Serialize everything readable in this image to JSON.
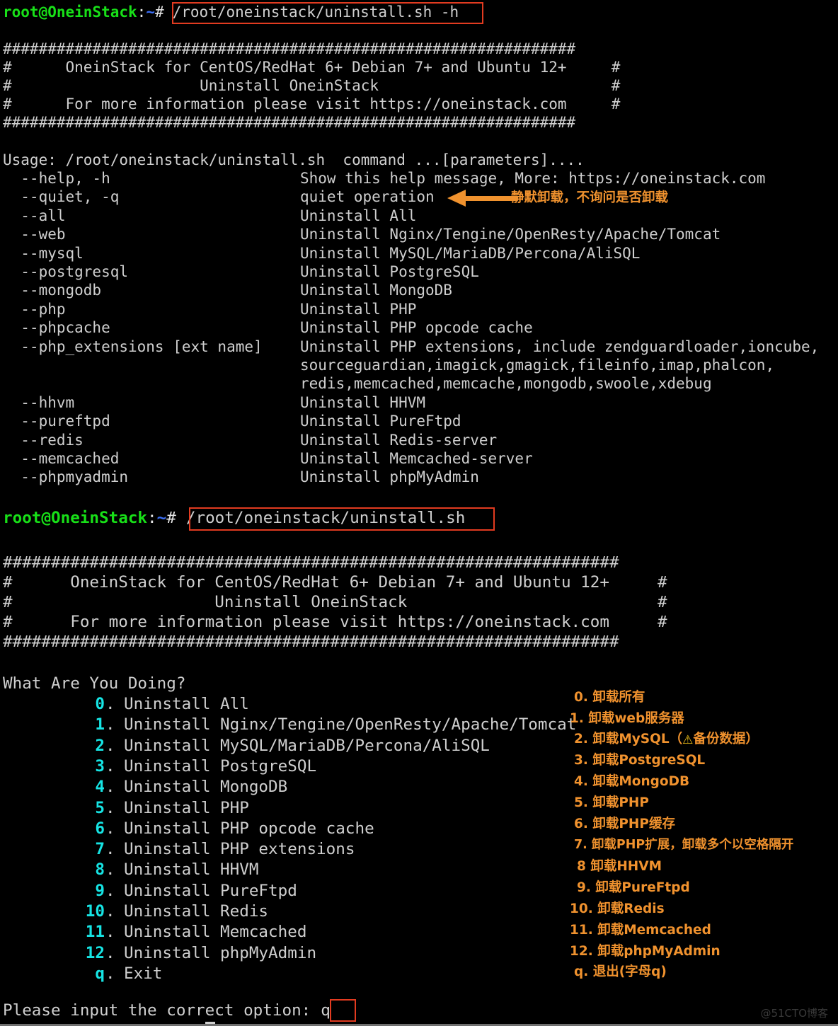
{
  "terminal": {
    "prompt": {
      "user_host": "root@OneinStack",
      "colon": ":",
      "path": "~",
      "sigil": "#"
    },
    "command_1": "/root/oneinstack/uninstall.sh -h",
    "command_2": "/root/oneinstack/uninstall.sh",
    "banner": {
      "rule": "################################################################",
      "line1": "#      OneinStack for CentOS/RedHat 6+ Debian 7+ and Ubuntu 12+     #",
      "line2": "#                     Uninstall OneinStack                          #",
      "line3": "#      For more information please visit https://oneinstack.com     #"
    },
    "usage_line": "Usage: /root/oneinstack/uninstall.sh  command ...[parameters]....",
    "options": [
      {
        "flag": "  --help, -h",
        "desc": "Show this help message, More: https://oneinstack.com"
      },
      {
        "flag": "  --quiet, -q",
        "desc": "quiet operation"
      },
      {
        "flag": "  --all",
        "desc": "Uninstall All"
      },
      {
        "flag": "  --web",
        "desc": "Uninstall Nginx/Tengine/OpenResty/Apache/Tomcat"
      },
      {
        "flag": "  --mysql",
        "desc": "Uninstall MySQL/MariaDB/Percona/AliSQL"
      },
      {
        "flag": "  --postgresql",
        "desc": "Uninstall PostgreSQL"
      },
      {
        "flag": "  --mongodb",
        "desc": "Uninstall MongoDB"
      },
      {
        "flag": "  --php",
        "desc": "Uninstall PHP"
      },
      {
        "flag": "  --phpcache",
        "desc": "Uninstall PHP opcode cache"
      },
      {
        "flag": "  --php_extensions [ext name]",
        "desc": "Uninstall PHP extensions, include zendguardloader,ioncube,"
      },
      {
        "flag": "",
        "desc": "sourceguardian,imagick,gmagick,fileinfo,imap,phalcon,"
      },
      {
        "flag": "",
        "desc": "redis,memcached,memcache,mongodb,swoole,xdebug"
      },
      {
        "flag": "  --hhvm",
        "desc": "Uninstall HHVM"
      },
      {
        "flag": "  --pureftpd",
        "desc": "Uninstall PureFtpd"
      },
      {
        "flag": "  --redis",
        "desc": "Uninstall Redis-server"
      },
      {
        "flag": "  --memcached",
        "desc": "Uninstall Memcached-server"
      },
      {
        "flag": "  --phpmyadmin",
        "desc": "Uninstall phpMyAdmin"
      }
    ],
    "menu_title": "What Are You Doing?",
    "menu_items": [
      {
        "key": "0",
        "label": "Uninstall All"
      },
      {
        "key": "1",
        "label": "Uninstall Nginx/Tengine/OpenResty/Apache/Tomcat"
      },
      {
        "key": "2",
        "label": "Uninstall MySQL/MariaDB/Percona/AliSQL"
      },
      {
        "key": "3",
        "label": "Uninstall PostgreSQL"
      },
      {
        "key": "4",
        "label": "Uninstall MongoDB"
      },
      {
        "key": "5",
        "label": "Uninstall PHP"
      },
      {
        "key": "6",
        "label": "Uninstall PHP opcode cache"
      },
      {
        "key": "7",
        "label": "Uninstall PHP extensions"
      },
      {
        "key": "8",
        "label": "Uninstall HHVM"
      },
      {
        "key": "9",
        "label": "Uninstall PureFtpd"
      },
      {
        "key": "10",
        "label": "Uninstall Redis"
      },
      {
        "key": "11",
        "label": "Uninstall Memcached"
      },
      {
        "key": "12",
        "label": "Uninstall phpMyAdmin"
      },
      {
        "key": "q",
        "label": "Exit"
      }
    ],
    "input_prompt": "Please input the correct option:",
    "input_value": "q"
  },
  "annotations": {
    "quiet": "静默卸载，不询问是否卸载",
    "menu": [
      "0. 卸载所有",
      "1. 卸载web服务器",
      "2. 卸载MySQL（",
      "3. 卸载PostgreSQL",
      "4. 卸载MongoDB",
      "5. 卸载PHP",
      "6. 卸载PHP缓存",
      "7. 卸载PHP扩展，卸载多个以空格隔开",
      "8 卸载HHVM",
      "9. 卸载PureFtpd",
      "10. 卸载Redis",
      "11. 卸载Memcached",
      "12. 卸载phpMyAdmin",
      "q. 退出(字母q)"
    ],
    "mysql_warn_suffix": "备份数据）",
    "warning_icon": "⚠"
  },
  "watermark": "@51CTO博客",
  "colors": {
    "background": "#000000",
    "foreground": "#cfcfcf",
    "prompt_green": "#18e018",
    "prompt_blue": "#3b6ef5",
    "menu_cyan": "#16e4e4",
    "annotation_orange": "#f0922e",
    "highlight_red": "#e23b20",
    "warning_yellow": "#f5c518"
  }
}
